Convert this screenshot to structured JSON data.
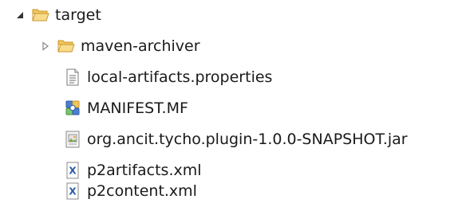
{
  "tree": {
    "root": {
      "label": "target",
      "expanded": true,
      "icon": "folder-open-icon",
      "children": [
        {
          "label": "maven-archiver",
          "type": "folder",
          "expanded": false,
          "icon": "folder-icon"
        },
        {
          "label": "local-artifacts.properties",
          "type": "file",
          "icon": "properties-file-icon"
        },
        {
          "label": "MANIFEST.MF",
          "type": "file",
          "icon": "manifest-file-icon"
        },
        {
          "label": "org.ancit.tycho.plugin-1.0.0-SNAPSHOT.jar",
          "type": "file",
          "icon": "jar-file-icon"
        },
        {
          "label": "p2artifacts.xml",
          "type": "file",
          "icon": "xml-file-icon"
        },
        {
          "label": "p2content.xml",
          "type": "file",
          "icon": "xml-file-icon"
        }
      ]
    }
  },
  "colors": {
    "folder_fill": "#f5d27a",
    "folder_stroke": "#c9962e",
    "xml_accent": "#2b5aa8",
    "twisty_expanded": "#333333",
    "twisty_collapsed": "#8a8a8a"
  }
}
